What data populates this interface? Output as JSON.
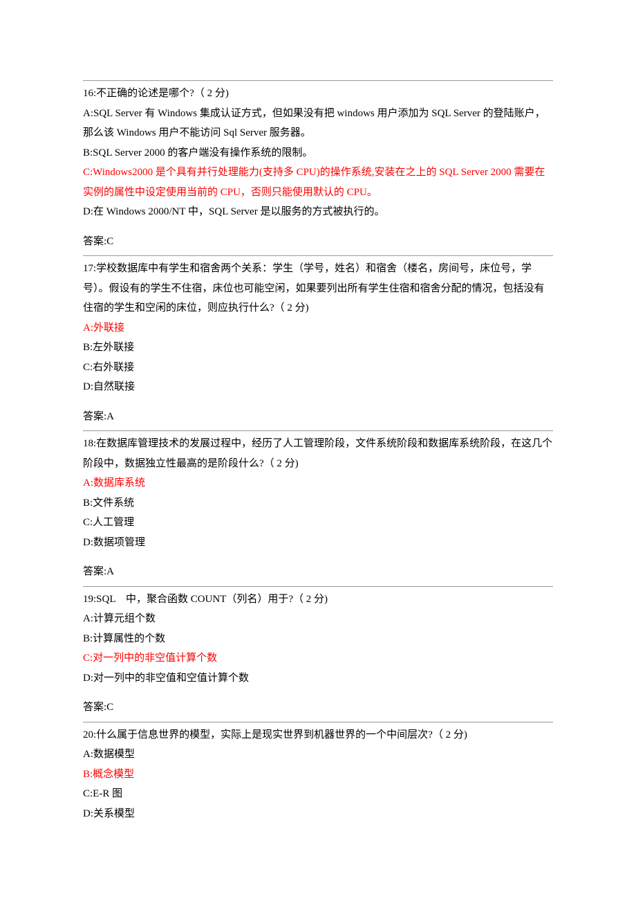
{
  "questions": [
    {
      "prompt_lines": [
        "16:不正确的论述是哪个?（ 2 分)"
      ],
      "options": [
        {
          "lines": [
            "A:SQL Server 有 Windows 集成认证方式，但如果没有把 windows 用户添加为 SQL Server 的登陆账户，那么该 Windows 用户不能访问 Sql Server 服务器。"
          ],
          "red": false
        },
        {
          "lines": [
            "B:SQL Server 2000 的客户端没有操作系统的限制。"
          ],
          "red": false
        },
        {
          "lines": [
            "C:Windows2000 是个具有并行处理能力(支持多 CPU)的操作系统,安装在之上的 SQL Server 2000 需要在实例的属性中设定使用当前的 CPU，否则只能使用默认的 CPU。"
          ],
          "red": true
        },
        {
          "lines": [
            "D:在 Windows 2000/NT 中，SQL Server 是以服务的方式被执行的。"
          ],
          "red": false
        }
      ],
      "answer": "答案:C"
    },
    {
      "prompt_lines": [
        "17:学校数据库中有学生和宿舍两个关系：学生（学号，姓名）和宿舍（楼名，房间号，床位号，学号）。假设有的学生不住宿，床位也可能空闲，如果要列出所有学生住宿和宿舍分配的情况，包括没有住宿的学生和空闲的床位，则应执行什么?（ 2 分)"
      ],
      "options": [
        {
          "lines": [
            "A:外联接"
          ],
          "red": true
        },
        {
          "lines": [
            "B:左外联接"
          ],
          "red": false
        },
        {
          "lines": [
            "C:右外联接"
          ],
          "red": false
        },
        {
          "lines": [
            "D:自然联接"
          ],
          "red": false
        }
      ],
      "answer": "答案:A"
    },
    {
      "prompt_lines": [
        "18:在数据库管理技术的发展过程中，经历了人工管理阶段，文件系统阶段和数据库系统阶段，在这几个阶段中，数据独立性最高的是阶段什么?（ 2 分)"
      ],
      "options": [
        {
          "lines": [
            "A:数据库系统"
          ],
          "red": true
        },
        {
          "lines": [
            "B:文件系统"
          ],
          "red": false
        },
        {
          "lines": [
            "C:人工管理"
          ],
          "red": false
        },
        {
          "lines": [
            "D:数据项管理"
          ],
          "red": false
        }
      ],
      "answer": "答案:A"
    },
    {
      "prompt_lines": [
        "19:SQL　中，聚合函数 COUNT（列名）用于?（ 2 分)"
      ],
      "options": [
        {
          "lines": [
            "A:计算元组个数"
          ],
          "red": false
        },
        {
          "lines": [
            "B:计算属性的个数"
          ],
          "red": false
        },
        {
          "lines": [
            "C:对一列中的非空值计算个数"
          ],
          "red": true
        },
        {
          "lines": [
            "D:对一列中的非空值和空值计算个数"
          ],
          "red": false
        }
      ],
      "answer": "答案:C"
    },
    {
      "prompt_lines": [
        "20:什么属于信息世界的模型，实际上是现实世界到机器世界的一个中间层次?（ 2 分)"
      ],
      "options": [
        {
          "lines": [
            "A:数据模型"
          ],
          "red": false
        },
        {
          "lines": [
            "B:概念模型"
          ],
          "red": true
        },
        {
          "lines": [
            "C:E-R 图"
          ],
          "red": false
        },
        {
          "lines": [
            "D:关系模型"
          ],
          "red": false
        }
      ],
      "answer": ""
    }
  ]
}
